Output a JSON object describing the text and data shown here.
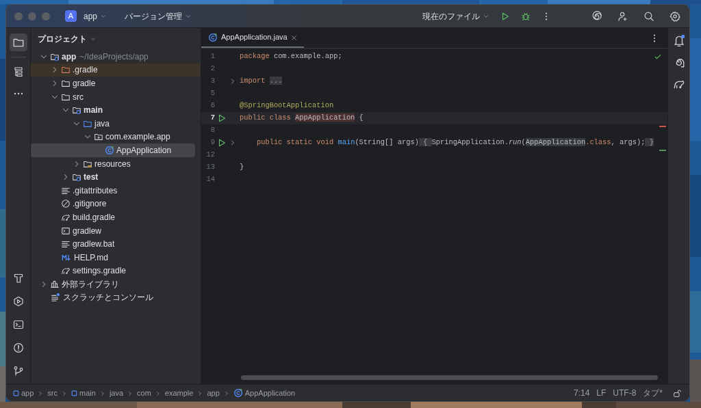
{
  "window": {
    "project_badge": "A",
    "project": "app",
    "vcs": "バージョン管理",
    "run_config": "現在のファイル"
  },
  "project_panel": {
    "title": "プロジェクト",
    "tree": [
      {
        "label": "app",
        "hint": "~/IdeaProjects/app",
        "kind": "module",
        "bold": true,
        "expanded": true,
        "selected": false,
        "children": [
          {
            "label": ".gradle",
            "kind": "excluded-folder",
            "expanded": false,
            "selected": false
          },
          {
            "label": "gradle",
            "kind": "folder",
            "expanded": false,
            "selected": false
          },
          {
            "label": "src",
            "kind": "folder",
            "expanded": true,
            "selected": false,
            "children": [
              {
                "label": "main",
                "kind": "module-folder",
                "bold": true,
                "expanded": true,
                "selected": false,
                "children": [
                  {
                    "label": "java",
                    "kind": "source-folder",
                    "expanded": true,
                    "selected": false,
                    "children": [
                      {
                        "label": "com.example.app",
                        "kind": "package",
                        "expanded": true,
                        "selected": false,
                        "children": [
                          {
                            "label": "AppApplication",
                            "kind": "class",
                            "selected": true
                          }
                        ]
                      }
                    ]
                  },
                  {
                    "label": "resources",
                    "kind": "resources-folder",
                    "expanded": false,
                    "selected": false
                  }
                ]
              },
              {
                "label": "test",
                "kind": "module-folder",
                "bold": true,
                "expanded": false,
                "selected": false
              }
            ]
          },
          {
            "label": ".gitattributes",
            "kind": "text",
            "selected": false
          },
          {
            "label": ".gitignore",
            "kind": "ignore",
            "selected": false
          },
          {
            "label": "build.gradle",
            "kind": "gradle",
            "selected": false
          },
          {
            "label": "gradlew",
            "kind": "terminal",
            "selected": false
          },
          {
            "label": "gradlew.bat",
            "kind": "text",
            "selected": false
          },
          {
            "label": "HELP.md",
            "kind": "markdown",
            "selected": false
          },
          {
            "label": "settings.gradle",
            "kind": "gradle",
            "selected": false
          }
        ]
      },
      {
        "label": "外部ライブラリ",
        "kind": "library",
        "expanded": false,
        "selected": false
      },
      {
        "label": "スクラッチとコンソール",
        "kind": "scratch",
        "selected": false
      }
    ]
  },
  "editor": {
    "tabs": [
      {
        "label": "AppApplication.java",
        "selected": true
      }
    ],
    "lines": [
      {
        "number": "1",
        "current": false,
        "run": false,
        "fold": false,
        "tokens": [
          {
            "text": "package",
            "kind": "keyword"
          },
          {
            "text": " com.example.app;",
            "kind": "plain"
          }
        ]
      },
      {
        "number": "2",
        "current": false,
        "run": false,
        "fold": false
      },
      {
        "number": "3",
        "current": false,
        "run": false,
        "fold": true,
        "tokens": [
          {
            "text": "import ",
            "kind": "keyword"
          },
          {
            "text": "...",
            "kind": "folded"
          }
        ]
      },
      {
        "number": "5",
        "current": false,
        "run": false,
        "fold": false
      },
      {
        "number": "6",
        "current": false,
        "run": false,
        "fold": false,
        "tokens": [
          {
            "text": "@SpringBootApplication",
            "kind": "annotation"
          }
        ]
      },
      {
        "number": "7",
        "current": true,
        "run": true,
        "fold": false,
        "tokens": [
          {
            "text": "public class ",
            "kind": "keyword"
          },
          {
            "text": "AppApplication",
            "kind": "declaration"
          },
          {
            "text": " {",
            "kind": "plain"
          }
        ]
      },
      {
        "number": "8",
        "current": false,
        "run": false,
        "fold": false
      },
      {
        "number": "9",
        "current": false,
        "run": true,
        "fold": true,
        "tokens": [
          {
            "text": "    public static void ",
            "kind": "keyword"
          },
          {
            "text": "main",
            "kind": "method"
          },
          {
            "text": "(String[] args)",
            "kind": "plain"
          },
          {
            "text": " { ",
            "kind": "folded"
          },
          {
            "text": "SpringApplication.",
            "kind": "plain"
          },
          {
            "text": "run",
            "kind": "static-call"
          },
          {
            "text": "(",
            "kind": "plain"
          },
          {
            "text": "AppApplication",
            "kind": "reference"
          },
          {
            "text": ".class",
            "kind": "keyword"
          },
          {
            "text": ", args);",
            "kind": "plain"
          },
          {
            "text": " }",
            "kind": "folded"
          }
        ]
      },
      {
        "number": "12",
        "current": false,
        "run": false,
        "fold": false
      },
      {
        "number": "13",
        "current": false,
        "run": false,
        "fold": false,
        "tokens": [
          {
            "text": "}",
            "kind": "plain"
          }
        ]
      },
      {
        "number": "14",
        "current": false,
        "run": false,
        "fold": false
      }
    ]
  },
  "status_bar": {
    "breadcrumbs": [
      {
        "label": "app",
        "kind": "module"
      },
      {
        "label": "src",
        "kind": "plain"
      },
      {
        "label": "main",
        "kind": "module"
      },
      {
        "label": "java",
        "kind": "plain"
      },
      {
        "label": "com",
        "kind": "plain"
      },
      {
        "label": "example",
        "kind": "plain"
      },
      {
        "label": "app",
        "kind": "plain"
      },
      {
        "label": "AppApplication",
        "kind": "class"
      }
    ],
    "position": "7:14",
    "line_ending": "LF",
    "encoding": "UTF-8",
    "indent": "タブ*"
  }
}
